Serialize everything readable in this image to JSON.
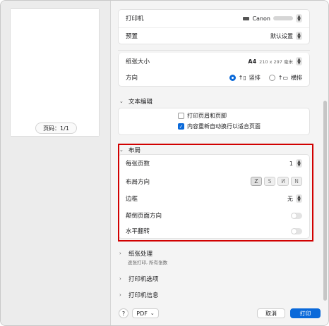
{
  "preview": {
    "page_label": "页码：1/1"
  },
  "printer": {
    "label": "打印机",
    "value": "Canon"
  },
  "preset": {
    "label": "预置",
    "value": "默认设置"
  },
  "paper_size": {
    "label": "纸张大小",
    "value": "A4",
    "detail": "210 x 297 毫米"
  },
  "orientation": {
    "label": "方向",
    "portrait": "竖排",
    "landscape": "横排",
    "selected": "portrait"
  },
  "text_editing": {
    "title": "文本编辑",
    "options": [
      {
        "label": "打印页眉和页脚",
        "checked": false
      },
      {
        "label": "内容重新自动换行以适合页面",
        "checked": true
      }
    ]
  },
  "layout": {
    "title": "布局",
    "pages_per_sheet_label": "每张页数",
    "pages_per_sheet_value": "1",
    "direction_label": "布局方向",
    "direction_glyphs": [
      "Z",
      "S",
      "И",
      "N"
    ],
    "border_label": "边框",
    "border_value": "无",
    "reverse_label": "颠倒页面方向",
    "flip_label": "水平翻转"
  },
  "paper_handling": {
    "title": "纸张处理",
    "subtitle": "逐张打印, 所有张数"
  },
  "printer_options": {
    "title": "打印机选项"
  },
  "printer_info": {
    "title": "打印机信息"
  },
  "footer": {
    "help": "?",
    "pdf": "PDF",
    "cancel": "取消",
    "print": "打印"
  },
  "colors": {
    "accent": "#0a69d9",
    "highlight": "#d10000"
  }
}
